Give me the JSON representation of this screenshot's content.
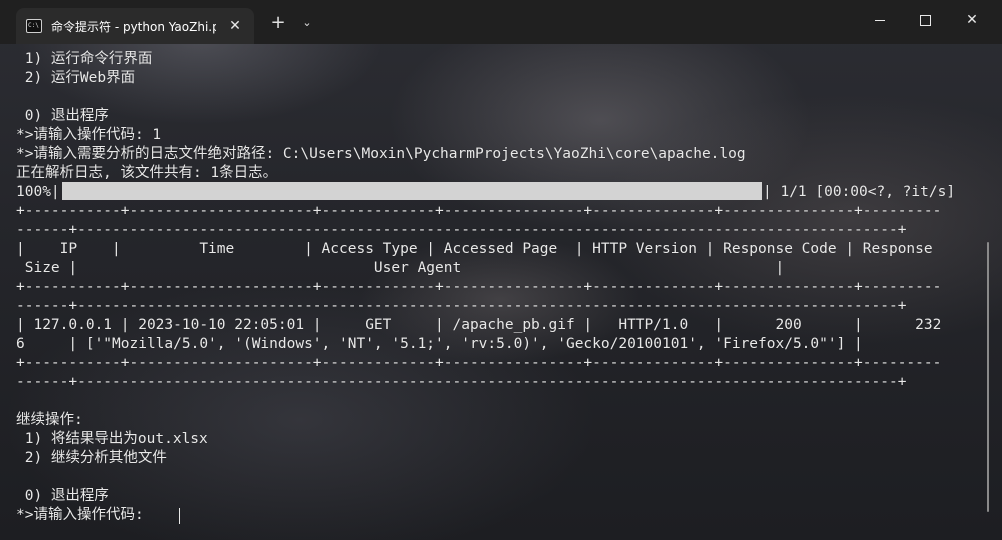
{
  "window": {
    "tab_title": "命令提示符 - python  YaoZhi.p",
    "tab_icon_text": "C:\\",
    "close_tab_glyph": "✕",
    "new_tab_glyph": "+",
    "dropdown_glyph": "⌄",
    "close_glyph": "✕"
  },
  "terminal": {
    "lines": [
      " 1) 运行命令行界面",
      " 2) 运行Web界面",
      "",
      " 0) 退出程序",
      "*>请输入操作代码: 1",
      "*>请输入需要分析的日志文件绝对路径: C:\\Users\\Moxin\\PycharmProjects\\YaoZhi\\core\\apache.log",
      "正在解析日志, 该文件共有: 1条日志。"
    ],
    "progress": {
      "percent_label": "100%|",
      "fraction": 1.0,
      "suffix": "| 1/1 [00:00<?, ?it/s]"
    },
    "table_lines": [
      "+-----------+---------------------+-------------+----------------+--------------+---------------+---------",
      "------+----------------------------------------------------------------------------------------------+",
      "|    IP    |         Time        | Access Type | Accessed Page  | HTTP Version | Response Code | Response",
      " Size |                                  User Agent                                    |",
      "+-----------+---------------------+-------------+----------------+--------------+---------------+---------",
      "------+----------------------------------------------------------------------------------------------+",
      "| 127.0.0.1 | 2023-10-10 22:05:01 |     GET     | /apache_pb.gif |   HTTP/1.0   |      200      |      232",
      "6     | ['\"Mozilla/5.0', '(Windows', 'NT', '5.1;', 'rv:5.0)', 'Gecko/20100101', 'Firefox/5.0\"'] |",
      "+-----------+---------------------+-------------+----------------+--------------+---------------+---------",
      "------+----------------------------------------------------------------------------------------------+"
    ],
    "after_lines": [
      "",
      "继续操作:",
      " 1) 将结果导出为out.xlsx",
      " 2) 继续分析其他文件",
      "",
      " 0) 退出程序",
      "*>请输入操作代码: "
    ]
  }
}
